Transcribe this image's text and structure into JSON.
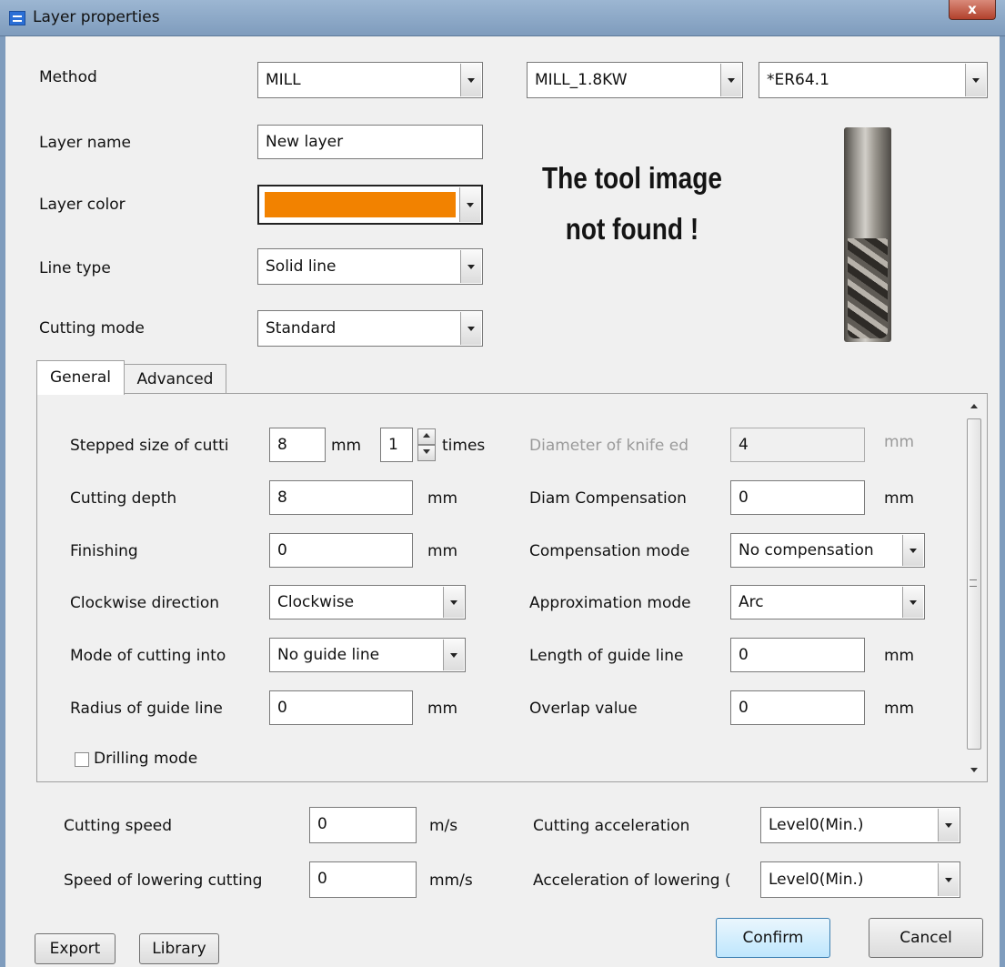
{
  "window": {
    "title": "Layer properties",
    "close_label": "x"
  },
  "header": {
    "method_label": "Method",
    "method_value": "MILL",
    "spindle_value": "MILL_1.8KW",
    "tool_value": "*ER64.1",
    "layer_name_label": "Layer name",
    "layer_name_value": "New layer",
    "layer_color_label": "Layer color",
    "layer_color": "#f28200",
    "line_type_label": "Line type",
    "line_type_value": "Solid line",
    "cutting_mode_label": "Cutting mode",
    "cutting_mode_value": "Standard",
    "tool_image_message_line1": "The tool image",
    "tool_image_message_line2": "not found !"
  },
  "tabs": [
    {
      "label": "General",
      "active": true
    },
    {
      "label": "Advanced",
      "active": false
    }
  ],
  "general": {
    "stepped_size_label": "Stepped size of cutti",
    "stepped_size_value": "8",
    "stepped_size_unit": "mm",
    "stepped_times_value": "1",
    "stepped_times_unit": "times",
    "knife_diameter_label": "Diameter of knife ed",
    "knife_diameter_value": "4",
    "knife_diameter_unit": "mm",
    "cutting_depth_label": "Cutting depth",
    "cutting_depth_value": "8",
    "cutting_depth_unit": "mm",
    "diam_comp_label": "Diam Compensation",
    "diam_comp_value": "0",
    "diam_comp_unit": "mm",
    "finishing_label": "Finishing",
    "finishing_value": "0",
    "finishing_unit": "mm",
    "comp_mode_label": "Compensation mode",
    "comp_mode_value": "No compensation",
    "clockwise_label": "Clockwise direction",
    "clockwise_value": "Clockwise",
    "approx_mode_label": "Approximation mode",
    "approx_mode_value": "Arc",
    "cut_into_label": "Mode of cutting into",
    "cut_into_value": "No guide line",
    "guide_length_label": "Length of guide line",
    "guide_length_value": "0",
    "guide_length_unit": "mm",
    "guide_radius_label": "Radius of guide line",
    "guide_radius_value": "0",
    "guide_radius_unit": "mm",
    "overlap_label": "Overlap value",
    "overlap_value": "0",
    "overlap_unit": "mm",
    "drilling_label": "Drilling mode",
    "drilling_checked": false
  },
  "speeds": {
    "cutting_speed_label": "Cutting speed",
    "cutting_speed_value": "0",
    "cutting_speed_unit": "m/s",
    "lowering_speed_label": "Speed of lowering cutting",
    "lowering_speed_value": "0",
    "lowering_speed_unit": "mm/s",
    "cutting_accel_label": "Cutting acceleration",
    "cutting_accel_value": "Level0(Min.)",
    "lowering_accel_label": "Acceleration of lowering (",
    "lowering_accel_value": "Level0(Min.)"
  },
  "buttons": {
    "export": "Export",
    "library": "Library",
    "confirm": "Confirm",
    "cancel": "Cancel"
  }
}
